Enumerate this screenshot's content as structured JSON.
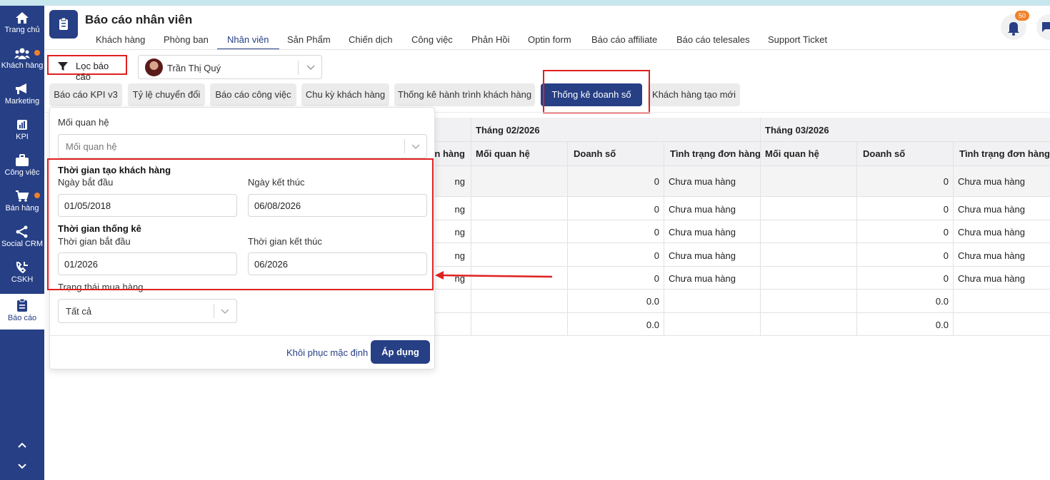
{
  "sidebar": {
    "items": [
      {
        "label": "Trang chủ",
        "icon": "home-icon",
        "dot": false,
        "active": false
      },
      {
        "label": "Khách hàng",
        "icon": "users-icon",
        "dot": true,
        "active": false
      },
      {
        "label": "Marketing",
        "icon": "megaphone-icon",
        "dot": false,
        "active": false
      },
      {
        "label": "KPI",
        "icon": "chart-icon",
        "dot": false,
        "active": false
      },
      {
        "label": "Công việc",
        "icon": "briefcase-icon",
        "dot": false,
        "active": false
      },
      {
        "label": "Bán hàng",
        "icon": "cart-icon",
        "dot": true,
        "active": false
      },
      {
        "label": "Social CRM",
        "icon": "share-icon",
        "dot": false,
        "active": false
      },
      {
        "label": "CSKH",
        "icon": "phone-icon",
        "dot": false,
        "active": false
      },
      {
        "label": "Báo cáo",
        "icon": "report-icon",
        "dot": false,
        "active": true
      }
    ],
    "accent": "#263f85",
    "dot_color": "#f0812b"
  },
  "header": {
    "title": "Báo cáo nhân viên",
    "notification_count": "50",
    "tabs": [
      {
        "label": "Khách hàng"
      },
      {
        "label": "Phòng ban"
      },
      {
        "label": "Nhân viên",
        "active": true
      },
      {
        "label": "Sản Phẩm"
      },
      {
        "label": "Chiến dịch"
      },
      {
        "label": "Công việc"
      },
      {
        "label": "Phản Hồi"
      },
      {
        "label": "Optin form"
      },
      {
        "label": "Báo cáo affiliate"
      },
      {
        "label": "Báo cáo telesales"
      },
      {
        "label": "Support Ticket"
      }
    ]
  },
  "filter": {
    "button_label": "Lọc báo cáo",
    "selected_user": "Trần Thị Quý"
  },
  "report_tabs": [
    {
      "label": "Báo cáo KPI v3"
    },
    {
      "label": "Tỷ lệ chuyển đổi"
    },
    {
      "label": "Báo cáo công việc"
    },
    {
      "label": "Chu kỳ khách hàng"
    },
    {
      "label": "Thống kê hành trình khách hàng"
    },
    {
      "label": "Thống kê doanh số",
      "active": true
    },
    {
      "label": "Khách hàng tạo mới"
    }
  ],
  "table": {
    "partial_header": "n hàng",
    "months": [
      "Tháng 02/2026",
      "Tháng 03/2026"
    ],
    "columns": [
      "Mối quan hệ",
      "Doanh số",
      "Tình trạng đơn hàng"
    ],
    "partial_cell": "ng",
    "rows": [
      {
        "m2_revenue": "0",
        "m2_status": "Chưa mua hàng",
        "m3_revenue": "0",
        "m3_status": "Chưa mua hàng"
      },
      {
        "m2_revenue": "0",
        "m2_status": "Chưa mua hàng",
        "m3_revenue": "0",
        "m3_status": "Chưa mua hàng"
      },
      {
        "m2_revenue": "0",
        "m2_status": "Chưa mua hàng",
        "m3_revenue": "0",
        "m3_status": "Chưa mua hàng"
      },
      {
        "m2_revenue": "0",
        "m2_status": "Chưa mua hàng",
        "m3_revenue": "0",
        "m3_status": "Chưa mua hàng"
      },
      {
        "m2_revenue": "0",
        "m2_status": "Chưa mua hàng",
        "m3_revenue": "0",
        "m3_status": "Chưa mua hàng"
      },
      {
        "m2_revenue": "0.0",
        "m2_status": "",
        "m3_revenue": "0.0",
        "m3_status": ""
      },
      {
        "m2_revenue": "0.0",
        "m2_status": "",
        "m3_revenue": "0.0",
        "m3_status": ""
      }
    ]
  },
  "filter_panel": {
    "relationship_label": "Mối quan hệ",
    "relationship_placeholder": "Mối quan hệ",
    "customer_created_heading": "Thời gian tạo khách hàng",
    "start_date_label": "Ngày bắt đầu",
    "start_date_value": "01/05/2018",
    "end_date_label": "Ngày kết thúc",
    "end_date_value": "06/08/2026",
    "stats_heading": "Thời gian thống kê",
    "stats_start_label": "Thời gian bắt đầu",
    "stats_start_value": "01/2026",
    "stats_end_label": "Thời gian kết thúc",
    "stats_end_value": "06/2026",
    "purchase_status_label": "Trạng thái mua hàng",
    "purchase_status_value": "Tất cả",
    "reset_label": "Khôi phục mặc định",
    "apply_label": "Áp dụng"
  },
  "annotation_color": "#e02020"
}
